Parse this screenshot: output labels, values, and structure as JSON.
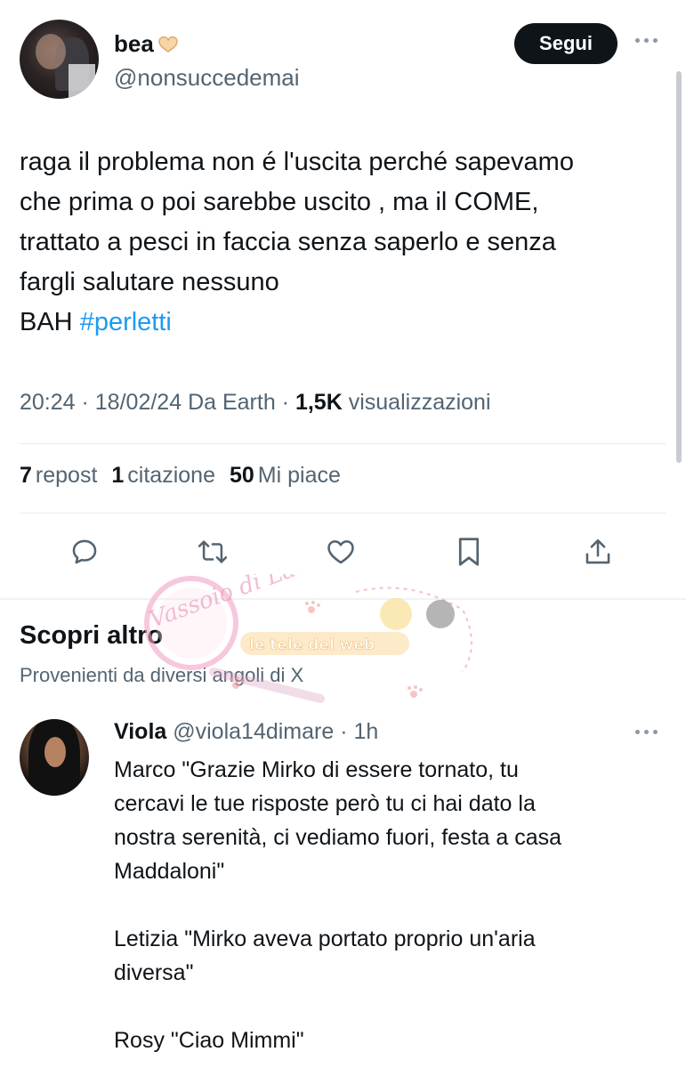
{
  "tweet": {
    "display_name": "bea",
    "handle": "@nonsuccedemai",
    "follow_label": "Segui",
    "text_lines": [
      "raga il problema non é l'uscita perché sapevamo",
      "che prima o poi sarebbe uscito , ma il COME,",
      "trattato a pesci in faccia senza saperlo e senza",
      "fargli salutare nessuno"
    ],
    "last_line_prefix": "BAH ",
    "hashtag": "#perletti",
    "time": "20:24",
    "date": "18/02/24",
    "source": "Da Earth",
    "views_count": "1,5K",
    "views_label": "visualizzazioni",
    "reposts_count": "7",
    "reposts_label": "repost",
    "quotes_count": "1",
    "quotes_label": "citazione",
    "likes_count": "50",
    "likes_label": "Mi piace"
  },
  "actions": {
    "icons": [
      "reply-icon",
      "repost-icon",
      "like-icon",
      "bookmark-icon",
      "share-icon"
    ]
  },
  "discover": {
    "title": "Scopri altro",
    "subtitle": "Provenienti da diversi angoli di X"
  },
  "watermark": {
    "text": "le tele del web",
    "signature": "Vassoio di Laris"
  },
  "reply": {
    "name": "Viola",
    "handle": "@viola14dimare",
    "time": "1h",
    "line1": "Marco \"Grazie Mirko di essere tornato, tu",
    "line2": "cercavi le tue risposte però tu ci hai dato la",
    "line3": "nostra serenità, ci vediamo fuori, festa a casa",
    "line4": "Maddaloni\"",
    "line5": "Letizia \"Mirko aveva portato proprio un'aria",
    "line6": "diversa\"",
    "line7": "Rosy \"Ciao Mimmi\""
  },
  "colors": {
    "accent": "#1d9bf0",
    "muted": "#536471",
    "text": "#0f1419"
  }
}
